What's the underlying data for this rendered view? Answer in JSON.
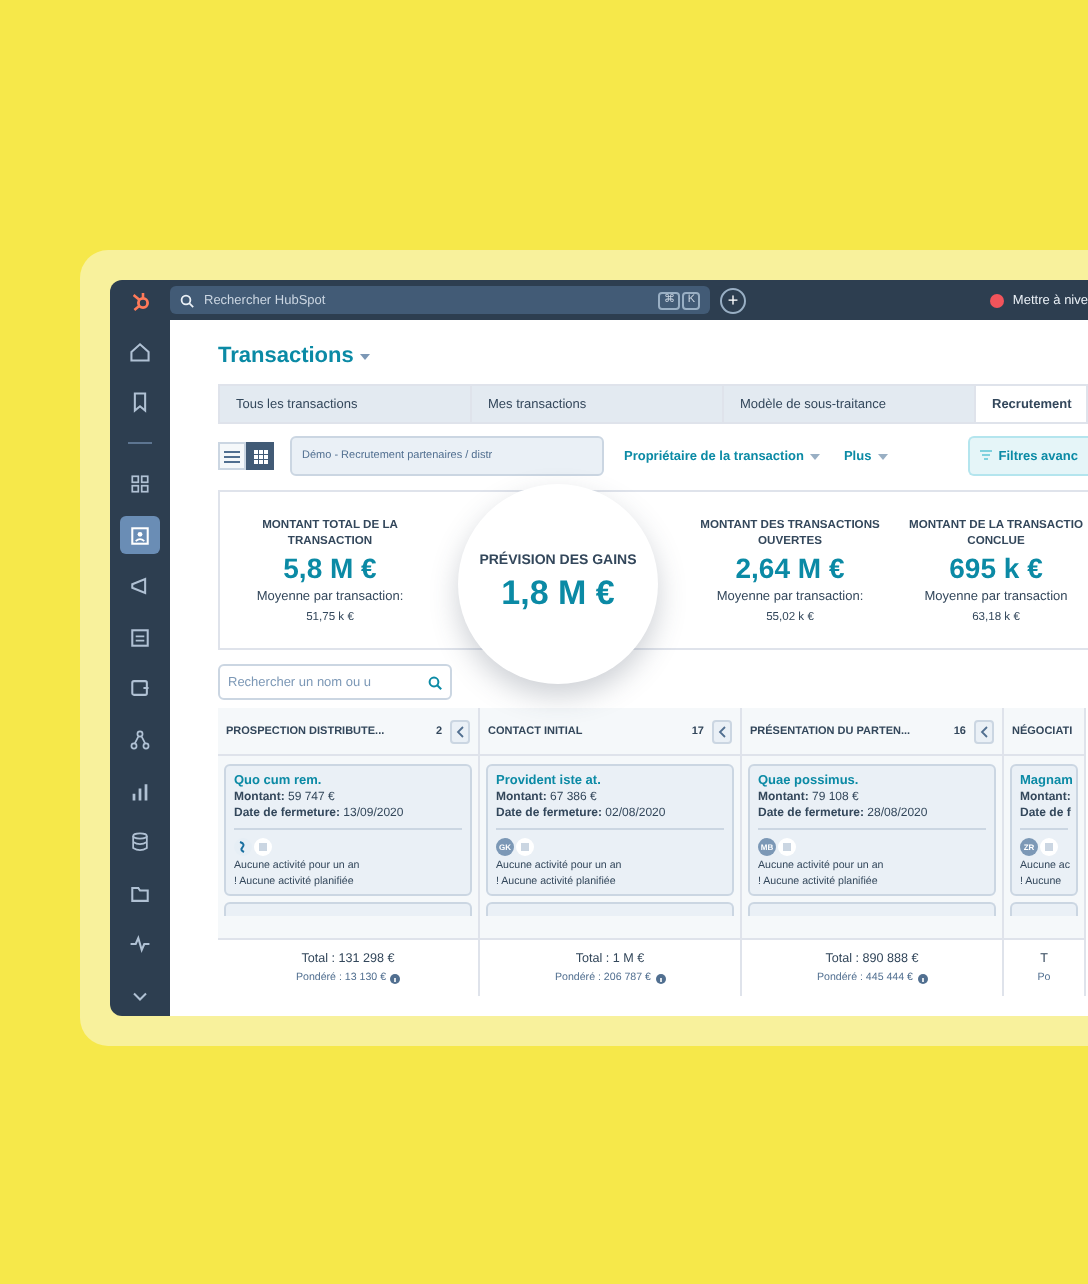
{
  "topbar": {
    "search_placeholder": "Rechercher HubSpot",
    "shortcut_keys": [
      "⌘",
      "K"
    ],
    "add_button": "+",
    "upgrade": "Mettre à nive"
  },
  "sidebar": {
    "items": [
      {
        "kind": "home",
        "selected": false
      },
      {
        "kind": "bookmark",
        "selected": false
      },
      {
        "kind": "divider"
      },
      {
        "kind": "grid",
        "selected": false
      },
      {
        "kind": "contacts",
        "selected": true
      },
      {
        "kind": "megaphone",
        "selected": false
      },
      {
        "kind": "document",
        "selected": false
      },
      {
        "kind": "wallet",
        "selected": false
      },
      {
        "kind": "network",
        "selected": false
      },
      {
        "kind": "chart",
        "selected": false
      },
      {
        "kind": "database",
        "selected": false
      },
      {
        "kind": "folder",
        "selected": false
      },
      {
        "kind": "pulse",
        "selected": false
      },
      {
        "kind": "chevron",
        "selected": false
      }
    ]
  },
  "page_title": "Transactions",
  "tabs": [
    {
      "label": "Tous les transactions",
      "selected": false
    },
    {
      "label": "Mes transactions",
      "selected": false
    },
    {
      "label": "Modèle de sous-traitance",
      "selected": false
    },
    {
      "label": "Recrutement",
      "selected": true
    }
  ],
  "toolbar": {
    "views": [
      {
        "kind": "list",
        "selected": false
      },
      {
        "kind": "board",
        "selected": true
      }
    ],
    "pipeline": "Démo - Recrutement partenaires / distr",
    "filters": [
      "Propriétaire de la transaction",
      "Plus"
    ],
    "advanced_filters": "Filtres avanc"
  },
  "kpis": [
    {
      "label": "MONTANT TOTAL DE LA TRANSACTION",
      "value": "5,8 M €",
      "avg_label": "Moyenne par transaction:",
      "avg": "51,75 k €",
      "highlighted": false
    },
    {
      "label": "PRÉVISION DES GAINS",
      "value": "1,8 M €",
      "highlighted": true
    },
    {
      "label": "MONTANT DES TRANSACTIONS OUVERTES",
      "value": "2,64 M €",
      "avg_label": "Moyenne par transaction:",
      "avg": "55,02 k €",
      "highlighted": false
    },
    {
      "label": "MONTANT DE LA TRANSACTIO CONCLUE",
      "value": "695 k €",
      "avg_label": "Moyenne par transaction",
      "avg": "63,18 k €",
      "highlighted": false
    }
  ],
  "board_search_placeholder": "Rechercher un nom ou u",
  "columns": [
    {
      "title": "PROSPECTION DISTRIBUTE...",
      "count": "2",
      "cards": [
        {
          "name": "Quo cum rem.",
          "amount_label": "Montant:",
          "amount": "59 747 €",
          "date_label": "Date de fermeture:",
          "date": "13/09/2020",
          "activity": "Aucune activité pour un an",
          "planned": "! Aucune activité planifiée"
        }
      ],
      "total": "Total : 131 298 €",
      "weighted": "Pondéré : 13 130 €"
    },
    {
      "title": "CONTACT INITIAL",
      "count": "17",
      "cards": [
        {
          "name": "Provident iste at.",
          "amount_label": "Montant:",
          "amount": "67 386 €",
          "date_label": "Date de fermeture:",
          "date": "02/08/2020",
          "initials": "GK",
          "activity": "Aucune activité pour un an",
          "planned": "! Aucune activité planifiée"
        }
      ],
      "total": "Total : 1 M €",
      "weighted": "Pondéré : 206 787 €"
    },
    {
      "title": "PRÉSENTATION DU PARTEN...",
      "count": "16",
      "cards": [
        {
          "name": "Quae possimus.",
          "amount_label": "Montant:",
          "amount": "79 108 €",
          "date_label": "Date de fermeture:",
          "date": "28/08/2020",
          "initials": "MB",
          "activity": "Aucune activité pour un an",
          "planned": "! Aucune activité planifiée"
        }
      ],
      "total": "Total : 890 888 €",
      "weighted": "Pondéré : 445 444 €"
    },
    {
      "title": "NÉGOCIATI",
      "cards": [
        {
          "name": "Magnam",
          "amount_label": "Montant:",
          "date_label": "Date de f",
          "initials": "ZR",
          "activity": "Aucune ac",
          "planned": "! Aucune"
        }
      ],
      "total": "T",
      "weighted": "Po"
    }
  ]
}
